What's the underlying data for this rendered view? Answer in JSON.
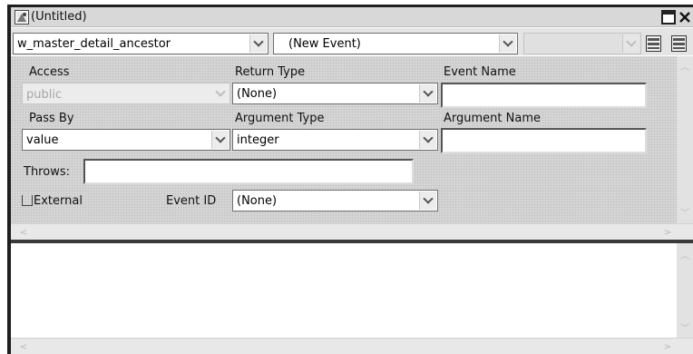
{
  "window": {
    "title": "(Untitled)"
  },
  "toolbar": {
    "object_select": "w_master_detail_ancestor",
    "event_select": "(New Event)",
    "third_select": ""
  },
  "form": {
    "access_label": "Access",
    "access_value": "public",
    "return_type_label": "Return Type",
    "return_type_value": "(None)",
    "event_name_label": "Event Name",
    "event_name_value": "",
    "pass_by_label": "Pass By",
    "pass_by_value": "value",
    "argument_type_label": "Argument Type",
    "argument_type_value": "integer",
    "argument_name_label": "Argument Name",
    "argument_name_value": "",
    "throws_label": "Throws:",
    "throws_value": "",
    "external_label": "External",
    "event_id_label": "Event ID",
    "event_id_value": "(None)"
  },
  "editor": {
    "content": ""
  }
}
